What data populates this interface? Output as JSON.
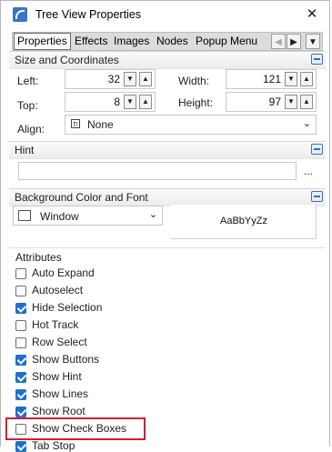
{
  "window": {
    "title": "Tree View Properties",
    "close_label": "✕"
  },
  "tabs": [
    "Properties",
    "Effects",
    "Images",
    "Nodes",
    "Popup Menu"
  ],
  "tab_nav": {
    "left": "◀",
    "right": "▶",
    "down": "▼"
  },
  "size_coordinates": {
    "title": "Size and Coordinates",
    "left_label": "Left:",
    "left_value": "32",
    "top_label": "Top:",
    "top_value": "8",
    "width_label": "Width:",
    "width_value": "121",
    "height_label": "Height:",
    "height_value": "97",
    "align_label": "Align:",
    "align_value": "None"
  },
  "hint": {
    "title": "Hint",
    "value": "",
    "ellipsis": "..."
  },
  "background": {
    "title": "Background Color and Font",
    "color_value": "Window",
    "font_preview": "AaBbYyZz"
  },
  "attributes": {
    "title": "Attributes",
    "items": [
      {
        "label": "Auto Expand",
        "checked": false
      },
      {
        "label": "Autoselect",
        "checked": false
      },
      {
        "label": "Hide Selection",
        "checked": true
      },
      {
        "label": "Hot Track",
        "checked": false
      },
      {
        "label": "Row Select",
        "checked": false
      },
      {
        "label": "Show Buttons",
        "checked": true
      },
      {
        "label": "Show Hint",
        "checked": true
      },
      {
        "label": "Show Lines",
        "checked": true
      },
      {
        "label": "Show Root",
        "checked": true
      },
      {
        "label": "Show Check Boxes",
        "checked": false
      },
      {
        "label": "Tab Stop",
        "checked": true
      }
    ]
  },
  "colors": {
    "accent": "#1f6fd1",
    "highlight_border": "#d0202e"
  }
}
